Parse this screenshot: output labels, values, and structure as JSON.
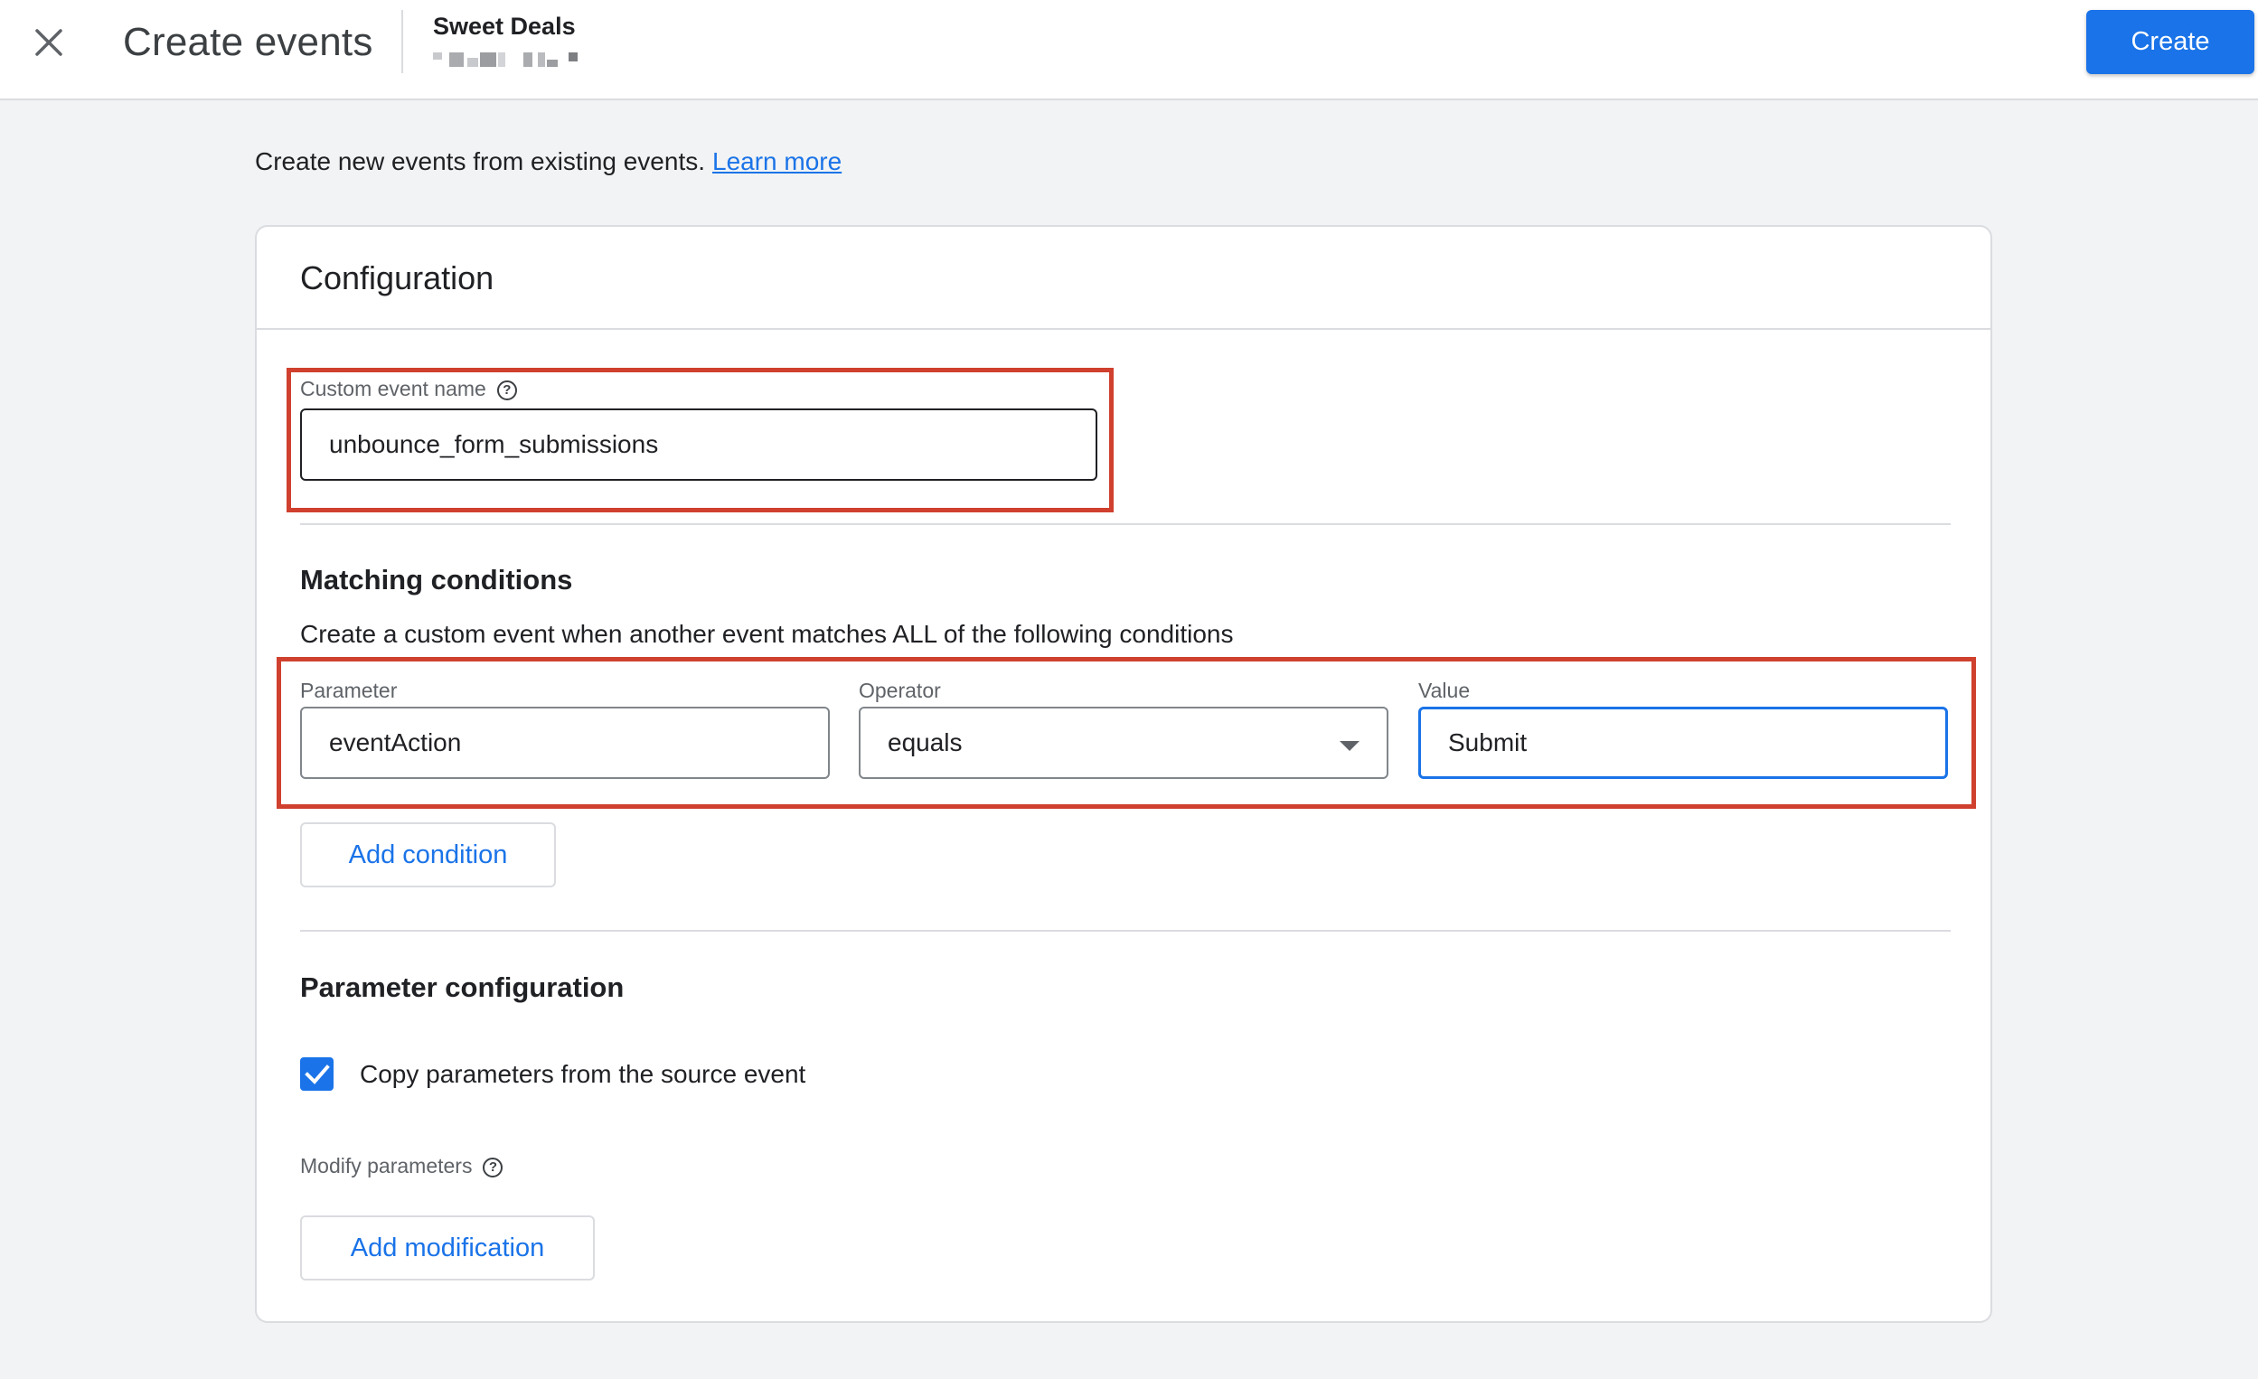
{
  "header": {
    "close_icon": "close-icon",
    "title": "Create events",
    "account_name": "Sweet Deals",
    "create_label": "Create"
  },
  "intro": {
    "text": "Create new events from existing events.",
    "link": "Learn more"
  },
  "configuration": {
    "title": "Configuration",
    "custom_event": {
      "label": "Custom event name",
      "help_icon": "help-icon",
      "value": "unbounce_form_submissions"
    },
    "matching": {
      "title": "Matching conditions",
      "description": "Create a custom event when another event matches ALL of the following conditions",
      "parameter": {
        "label": "Parameter",
        "value": "eventAction"
      },
      "operator": {
        "label": "Operator",
        "value": "equals"
      },
      "value": {
        "label": "Value",
        "value": "Submit"
      },
      "add_condition": "Add condition"
    },
    "parameter_config": {
      "title": "Parameter configuration",
      "copy_checkbox": {
        "label": "Copy parameters from the source event",
        "checked": true
      },
      "modify_label": "Modify parameters",
      "add_modification": "Add modification"
    }
  },
  "colors": {
    "accent": "#1a73e8",
    "highlight": "#d0402e",
    "background": "#f1f3f4"
  }
}
